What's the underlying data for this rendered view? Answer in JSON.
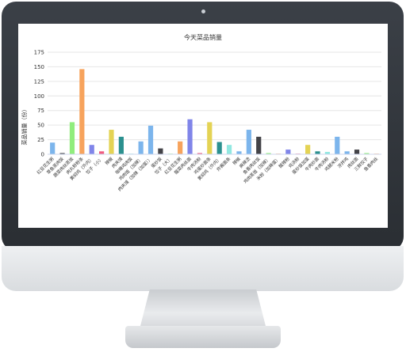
{
  "chart_data": {
    "type": "bar",
    "title": "今天菜品销量",
    "ylabel": "菜品销量（份）",
    "xlabel": "",
    "ylim": [
      0,
      175
    ],
    "yticks": [
      0,
      25,
      50,
      75,
      100,
      125,
      150,
      175
    ],
    "grid": true,
    "categories": [
      "红豆花生粥",
      "草鱼蒸肉饭",
      "蔬菜肉丝蒸饭",
      "肉丸粉粉条",
      "黄焖鸡（外内）",
      "饺子（小）",
      "辣椒",
      "肉夹馍",
      "咖喱鸡肉饭",
      "鸡肉饭（加辣）",
      "肉夹馍（加辣（加蛋））",
      "蛋炒饭",
      "饺子（大）",
      "红豆花生粥",
      "酸菜肉丝面",
      "牛肉汤粉",
      "鸡蛋炒面条",
      "黄焖鸡（外内）",
      "炸酱面条",
      "辣椒",
      "麻辣烫",
      "鱼香肉丝饭",
      "鸡肉蒸饭（加辣）",
      "米粉（加辣蛋）",
      "酸辣粉",
      "鸡汤粉",
      "蛋炒饭加蛋",
      "牛肉炒面",
      "牛肉汤粉",
      "鸡腿米粉",
      "凉拌鸡",
      "肉丝面",
      "三鲜饺子",
      "鱼香肉丝"
    ],
    "values": [
      20,
      2,
      55,
      146,
      16,
      5,
      42,
      30,
      1,
      22,
      49,
      10,
      1,
      22,
      60,
      2,
      55,
      21,
      16,
      5,
      42,
      30,
      2,
      1,
      8,
      1,
      16,
      5,
      4,
      30,
      5,
      8,
      2,
      1
    ],
    "colors": [
      "#7cb5ec",
      "#434348",
      "#90ed7d",
      "#f7a35c",
      "#8085e9",
      "#f15c80",
      "#e4d354",
      "#2b908f",
      "#91e8e1",
      "#7cb5ec"
    ]
  }
}
